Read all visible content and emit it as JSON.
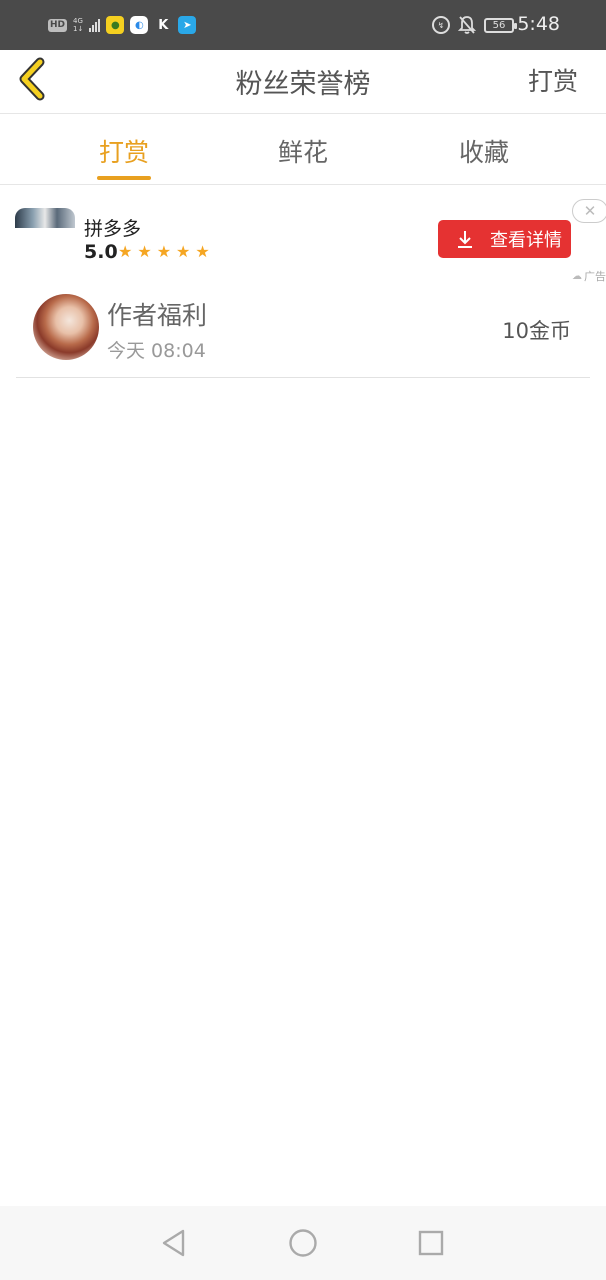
{
  "status_bar": {
    "hd_badge": "HD",
    "network_top": "4G",
    "network_bottom": "1↓",
    "app_icon_k": "K",
    "battery": "56",
    "time": "5:48",
    "icons": [
      "signal-icon",
      "app-bean-icon",
      "app-browser-icon",
      "app-k-icon",
      "app-telegram-icon",
      "data-saver-icon",
      "notifications-off-icon",
      "battery-icon"
    ]
  },
  "header": {
    "title": "粉丝荣誉榜",
    "right_action": "打赏",
    "back_icon": "chevron-left-icon"
  },
  "tabs": [
    {
      "label": "打赏",
      "active": true
    },
    {
      "label": "鲜花",
      "active": false
    },
    {
      "label": "收藏",
      "active": false
    }
  ],
  "colors": {
    "accent": "#e8a020",
    "ad_button": "#e53232",
    "star": "#f5a623"
  },
  "ad": {
    "app_name": "拼多多",
    "rating": "5.0",
    "stars": 5,
    "button_label": "查看详情",
    "button_icon": "download-icon",
    "close_icon": "close-icon",
    "tag": "广告"
  },
  "records": [
    {
      "name": "作者福利",
      "time": "今天 08:04",
      "amount": "10金币"
    }
  ],
  "nav": {
    "icons": [
      "back-triangle-icon",
      "home-circle-icon",
      "recents-square-icon"
    ]
  }
}
